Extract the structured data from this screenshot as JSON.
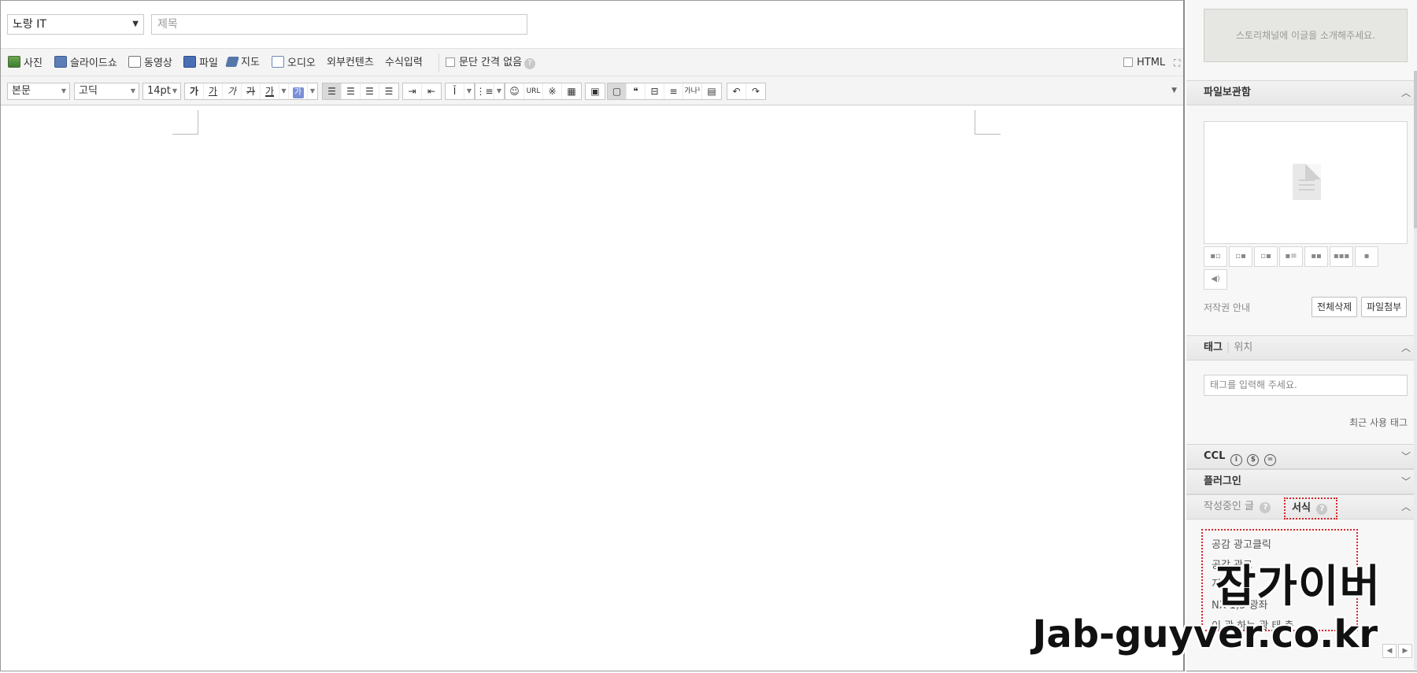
{
  "editor": {
    "category": {
      "selected": "노랑 IT"
    },
    "title_placeholder": "제목",
    "insert_bar": {
      "photo": "사진",
      "slideshow": "슬라이드쇼",
      "video": "동영상",
      "file": "파일",
      "map": "지도",
      "audio": "오디오",
      "external": "외부컨텐츠",
      "formula": "수식입력",
      "no_paragraph_spacing": "문단 간격 없음",
      "html": "HTML"
    },
    "format_bar": {
      "paragraph_style": "본문",
      "font": "고딕",
      "size": "14pt",
      "bold": "가",
      "underline": "가",
      "italic": "가",
      "strike": "가",
      "font_color": "가",
      "bg_color": "가",
      "url": "URL",
      "special_char": "※",
      "quote": "❝",
      "spell": "가나¹"
    }
  },
  "sidebar": {
    "story_channel_placeholder": "스토리채널에 이글을 소개해주세요.",
    "file_storage": {
      "title": "파일보관함",
      "copyright": "저작권 안내",
      "delete_all": "전체삭제",
      "attach_file": "파일첨부"
    },
    "tags": {
      "title": "태그",
      "location": "위치",
      "placeholder": "태그를 입력해 주세요.",
      "recent": "최근 사용 태그"
    },
    "ccl": {
      "title": "CCL"
    },
    "plugins": {
      "title": "플러그인"
    },
    "formats": {
      "writing_tab": "작성중인 글",
      "formats_tab": "서식",
      "items": [
        "공감 광고클릭",
        "공감 광고",
        "지",
        "NX 1,5 광좌",
        "이 광 하는 광 태 충"
      ]
    }
  },
  "watermark": {
    "title": "잡가이버",
    "url": "Jab-guyver.co.kr"
  }
}
